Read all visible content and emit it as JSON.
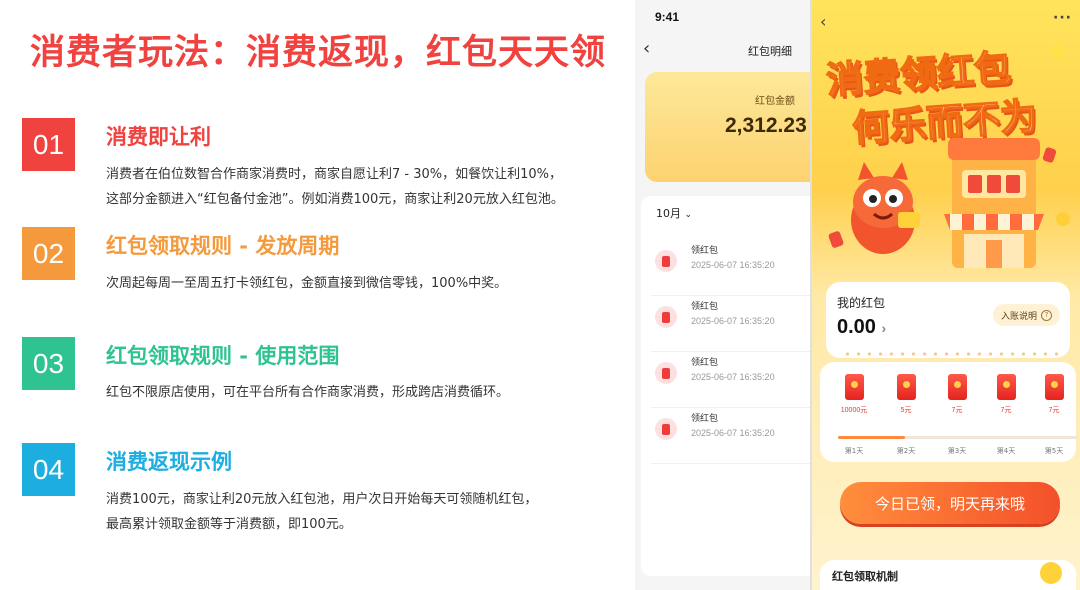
{
  "slide": {
    "title": "消费者玩法：消费返现，红包天天领",
    "sections": [
      {
        "number": "01",
        "color": "#f0423f",
        "heading": "消费即让利",
        "lines": [
          "消费者在伯位数智合作商家消费时，商家自愿让利7 - 30%，如餐饮让利10%，",
          "这部分金额进入“红包备付金池”。例如消费100元，商家让利20元放入红包池。"
        ]
      },
      {
        "number": "02",
        "color": "#f59a3c",
        "heading": "红包领取规则 - 发放周期",
        "lines": [
          "次周起每周一至周五打卡领红包，金额直接到微信零钱，100%中奖。"
        ]
      },
      {
        "number": "03",
        "color": "#2fc391",
        "heading": "红包领取规则 - 使用范围",
        "lines": [
          "红包不限原店使用，可在平台所有合作商家消费，形成跨店消费循环。"
        ]
      },
      {
        "number": "04",
        "color": "#1daee0",
        "heading": "消费返现示例",
        "lines": [
          "消费100元，商家让利20元放入红包池，用户次日开始每天可领随机红包，",
          "最高累计领取金额等于消费额，即100元。"
        ]
      }
    ]
  },
  "detail_screen": {
    "status_time": "9:41",
    "back_icon": "chevron-left-icon",
    "title": "红包明细",
    "balance_label": "红包金额",
    "balance_amount": "2,312.23",
    "month_filter": "10月",
    "records": [
      {
        "name": "领红包",
        "time": "2025-06-07 16:35:20"
      },
      {
        "name": "领红包",
        "time": "2025-06-07 16:35:20"
      },
      {
        "name": "领红包",
        "time": "2025-06-07 16:35:20"
      },
      {
        "name": "领红包",
        "time": "2025-06-07 16:35:20"
      }
    ]
  },
  "reward_screen": {
    "banner_line1": "消费领红包",
    "banner_line2": "何乐而不为",
    "my_label": "我的红包",
    "my_amount": "0.00",
    "info_label": "入账说明",
    "days": [
      {
        "value": "10000元",
        "label": "第1天"
      },
      {
        "value": "5元",
        "label": "第2天"
      },
      {
        "value": "7元",
        "label": "第3天"
      },
      {
        "value": "7元",
        "label": "第4天"
      },
      {
        "value": "7元",
        "label": "第5天"
      }
    ],
    "progress": 0.28,
    "button_label": "今日已领，明天再来哦",
    "footer_title": "红包领取机制"
  }
}
